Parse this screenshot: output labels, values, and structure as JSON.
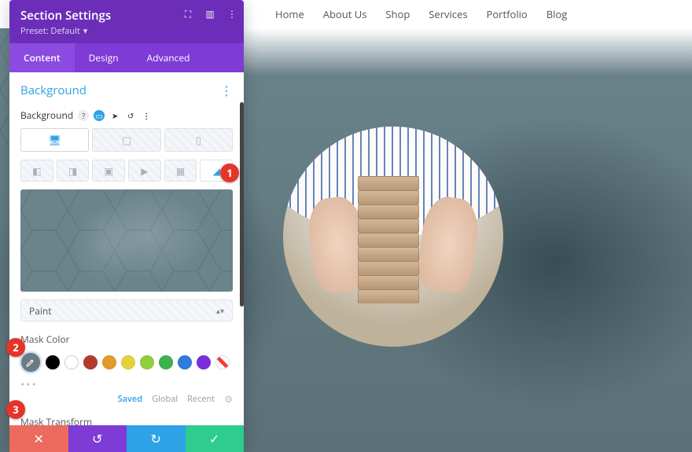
{
  "nav": {
    "items": [
      "Home",
      "About Us",
      "Shop",
      "Services",
      "Portfolio",
      "Blog"
    ]
  },
  "panel": {
    "title": "Section Settings",
    "preset_label": "Preset: Default",
    "tabs": {
      "content": "Content",
      "design": "Design",
      "advanced": "Advanced",
      "active": "content"
    },
    "section": "Background",
    "bg_label": "Background",
    "select_value": "Paint",
    "mask_color_label": "Mask Color",
    "mask_transform_label": "Mask Transform",
    "swatch_colors": [
      "#000000",
      "#ffffff",
      "#b23a2e",
      "#e29a2d",
      "#e4d23a",
      "#8fcf3c",
      "#3bb24a",
      "#2e7adf",
      "#7a2edb"
    ],
    "palette_tabs": {
      "saved": "Saved",
      "global": "Global",
      "recent": "Recent",
      "active": "saved"
    }
  },
  "annotations": [
    "1",
    "2",
    "3"
  ]
}
